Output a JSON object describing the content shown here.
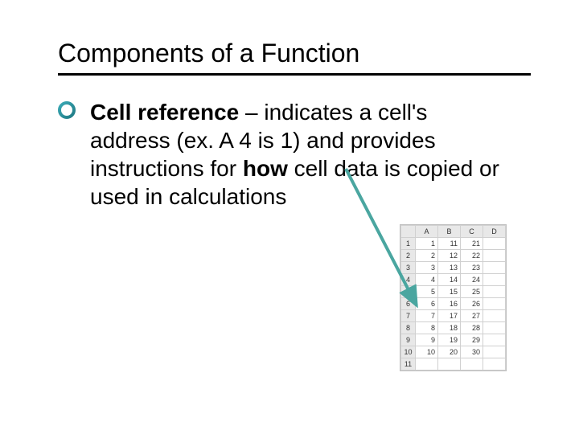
{
  "title": "Components of a Function",
  "bullet": {
    "term": "Cell reference",
    "rest_before_how": " – indicates a cell's address (ex. A 4 is 1) and provides instructions for ",
    "how": "how",
    "rest_after_how": " cell data is copied or used in calculations"
  },
  "sheet": {
    "columns": [
      "A",
      "B",
      "C",
      "D"
    ],
    "rows": [
      {
        "n": "1",
        "cells": [
          "1",
          "11",
          "21",
          ""
        ]
      },
      {
        "n": "2",
        "cells": [
          "2",
          "12",
          "22",
          ""
        ]
      },
      {
        "n": "3",
        "cells": [
          "3",
          "13",
          "23",
          ""
        ]
      },
      {
        "n": "4",
        "cells": [
          "4",
          "14",
          "24",
          ""
        ]
      },
      {
        "n": "5",
        "cells": [
          "5",
          "15",
          "25",
          ""
        ]
      },
      {
        "n": "6",
        "cells": [
          "6",
          "16",
          "26",
          ""
        ]
      },
      {
        "n": "7",
        "cells": [
          "7",
          "17",
          "27",
          ""
        ]
      },
      {
        "n": "8",
        "cells": [
          "8",
          "18",
          "28",
          ""
        ]
      },
      {
        "n": "9",
        "cells": [
          "9",
          "19",
          "29",
          ""
        ]
      },
      {
        "n": "10",
        "cells": [
          "10",
          "20",
          "30",
          ""
        ]
      },
      {
        "n": "11",
        "cells": [
          "",
          "",
          "",
          ""
        ]
      }
    ]
  }
}
